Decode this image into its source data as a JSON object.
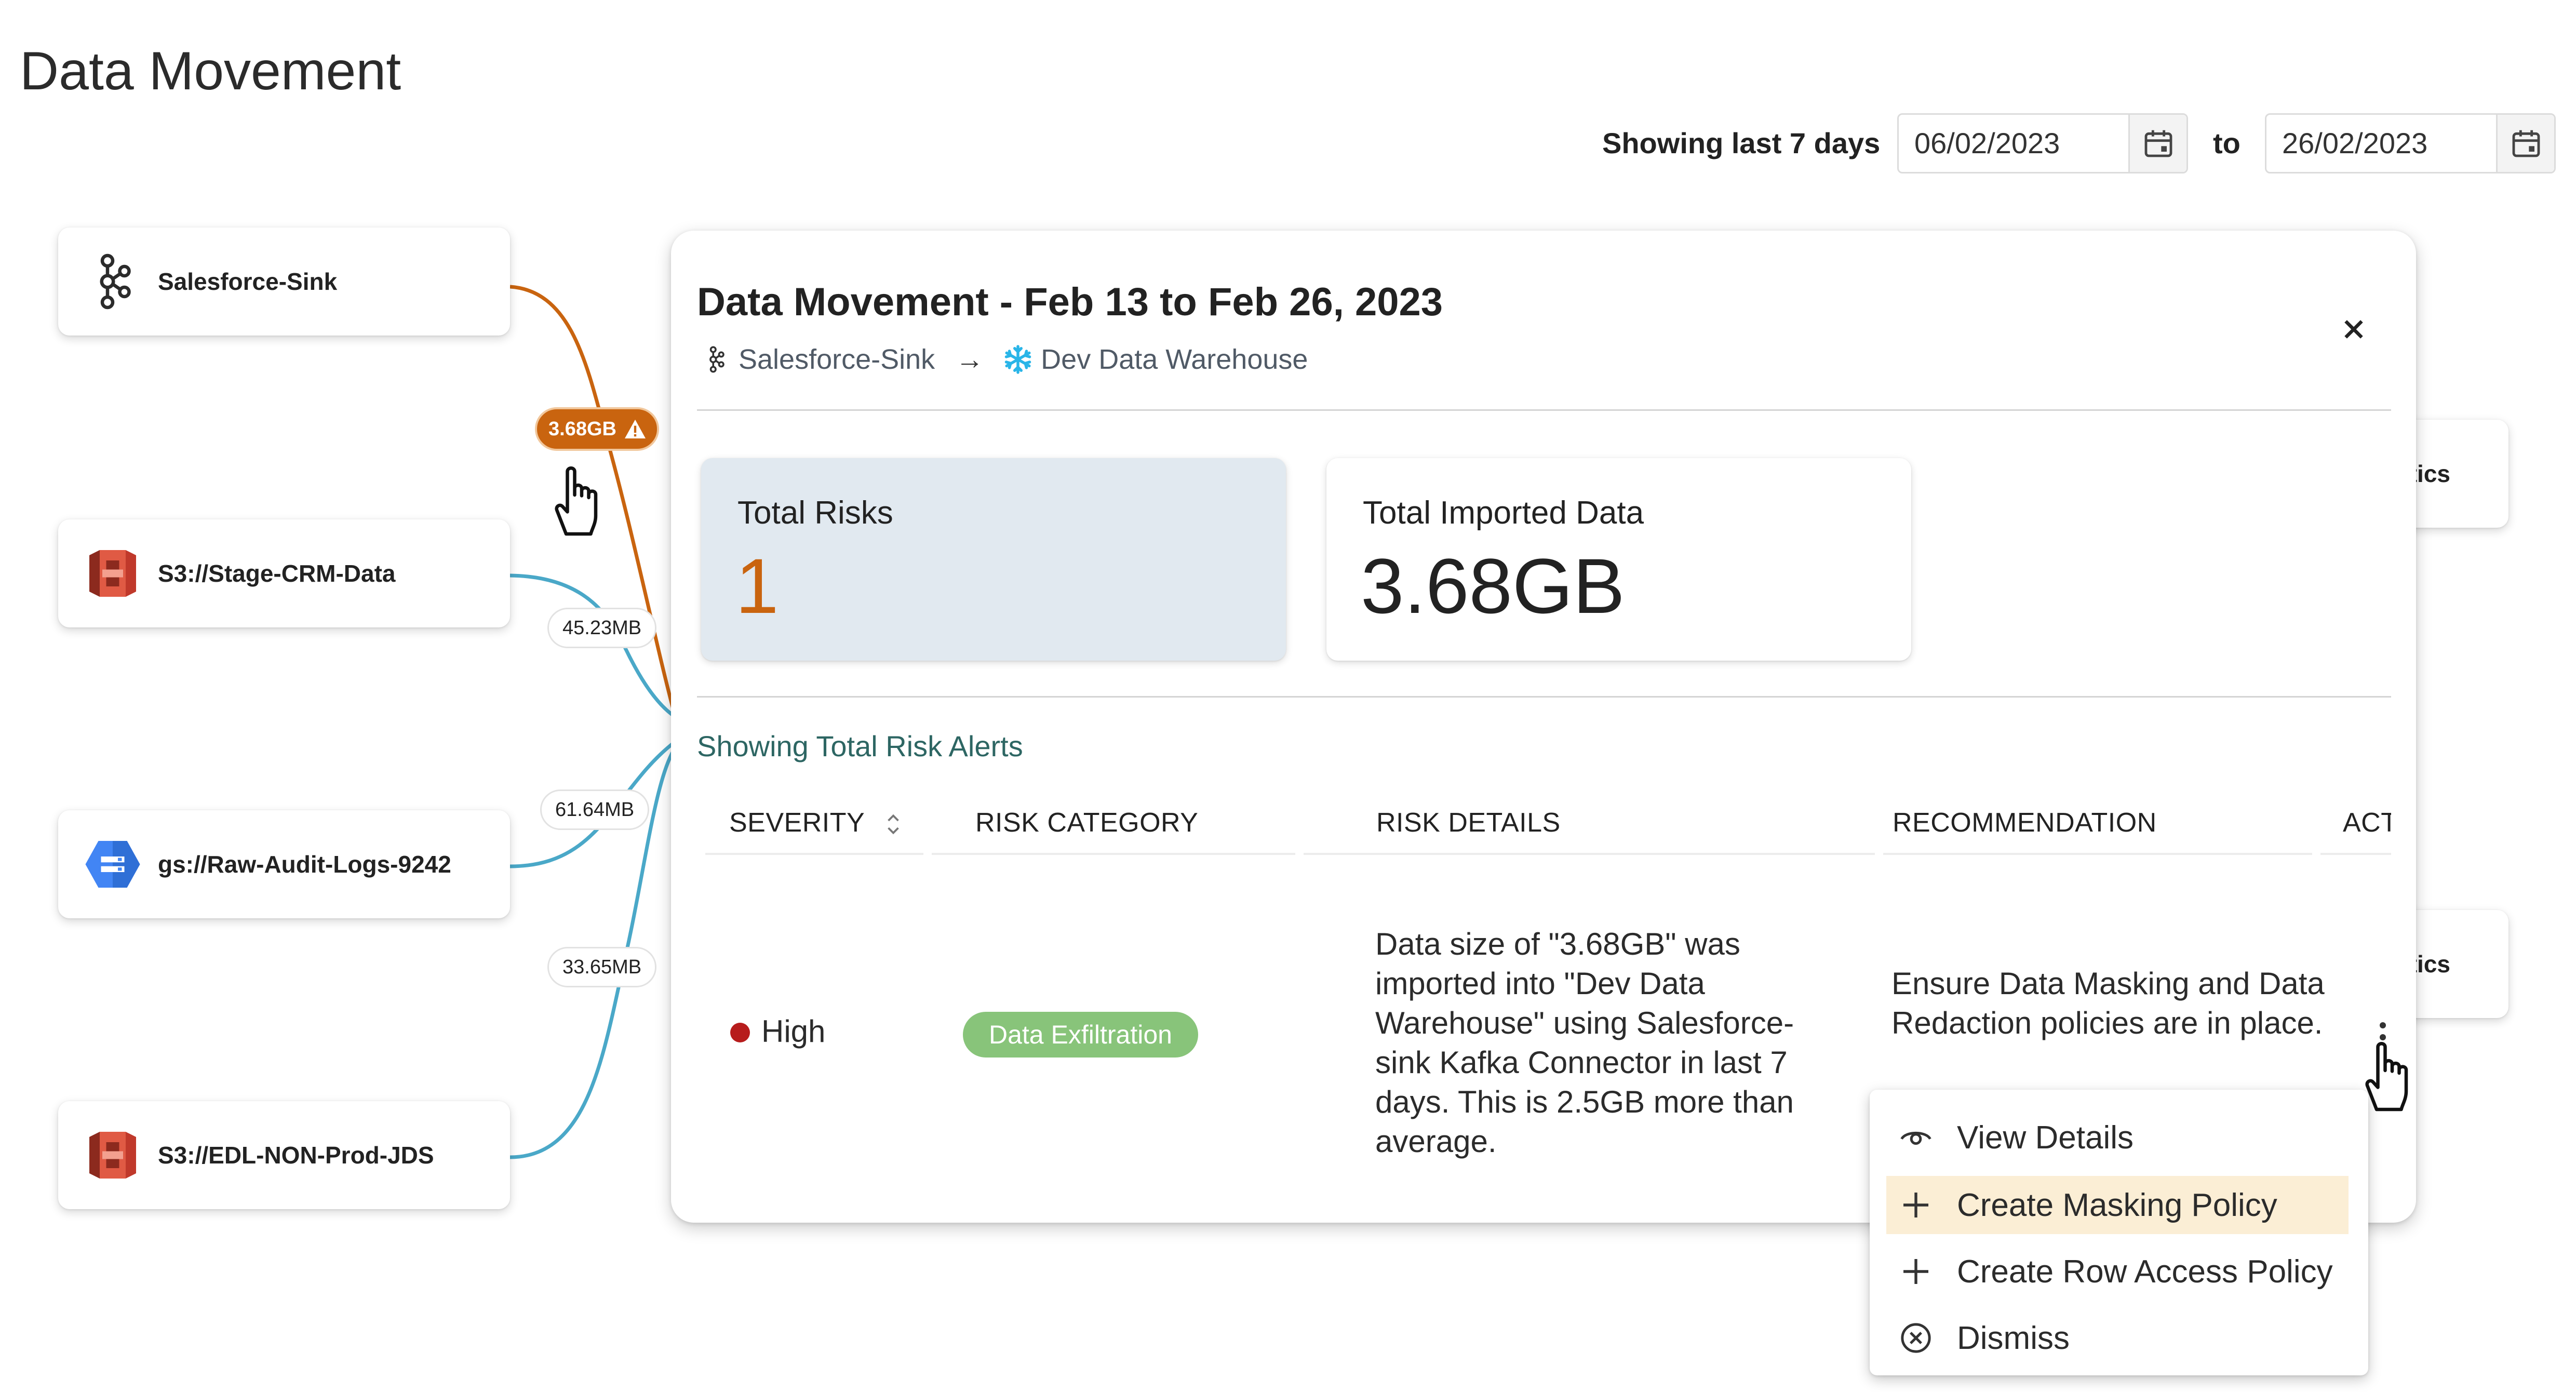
{
  "page": {
    "title": "Data Movement"
  },
  "date_range": {
    "label": "Showing last 7 days",
    "from": "06/02/2023",
    "to_label": "to",
    "to": "26/02/2023"
  },
  "sources": [
    {
      "label": "Salesforce-Sink",
      "icon": "kafka-icon"
    },
    {
      "label": "S3://Stage-CRM-Data",
      "icon": "aws-s3-icon"
    },
    {
      "label": "gs://Raw-Audit-Logs-9242",
      "icon": "gcs-icon"
    },
    {
      "label": "S3://EDL-NON-Prod-JDS",
      "icon": "aws-s3-icon"
    }
  ],
  "destinations": [
    {
      "label": "tics"
    },
    {
      "label": "ytics"
    }
  ],
  "edges": {
    "alert": {
      "label": "3.68GB",
      "color": "#c9640f"
    },
    "stage_crm": "45.23MB",
    "raw_audit": "61.64MB",
    "edl": "33.65MB",
    "line_color": "#4aa8c8"
  },
  "modal": {
    "title": "Data Movement - Feb 13 to Feb 26, 2023",
    "source": "Salesforce-Sink",
    "destination": "Dev Data Warehouse",
    "metrics": {
      "risks_label": "Total Risks",
      "risks_value": "1",
      "imported_label": "Total Imported Data",
      "imported_value": "3.68GB"
    },
    "alerts_label": "Showing Total Risk Alerts",
    "table": {
      "headers": [
        "SEVERITY",
        "RISK CATEGORY",
        "RISK DETAILS",
        "RECOMMENDATION",
        "ACTION"
      ],
      "row": {
        "severity": "High",
        "category": "Data Exfiltration",
        "details": "Data size of \"3.68GB\" was imported into \"Dev Data Warehouse\" using Salesforce-sink Kafka Connector in last 7 days. This is 2.5GB more than average.",
        "recommendation": "Ensure Data Masking and Data Redaction policies are in place."
      }
    }
  },
  "action_menu": [
    {
      "label": "View Details",
      "icon": "eye-icon"
    },
    {
      "label": "Create Masking Policy",
      "icon": "plus-icon",
      "highlighted": true
    },
    {
      "label": "Create Row Access Policy",
      "icon": "plus-icon"
    },
    {
      "label": "Dismiss",
      "icon": "close-circle-icon"
    }
  ],
  "colors": {
    "accent": "#c9640f",
    "teal": "#2d6663",
    "risk_card_bg": "#e1e9f0",
    "pill": "#88c47a",
    "severity_high": "#b71c1c",
    "menu_highlight": "#fbeed5"
  }
}
